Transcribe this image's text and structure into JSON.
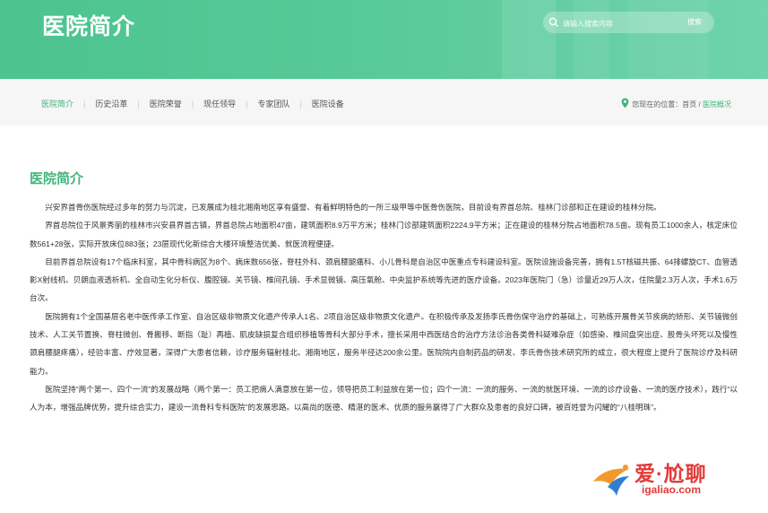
{
  "banner": {
    "title": "医院简介"
  },
  "search": {
    "placeholder": "请输入搜索内容",
    "button": "搜索"
  },
  "nav": {
    "tabs": [
      "医院简介",
      "历史沿革",
      "医院荣誉",
      "现任领导",
      "专家团队",
      "医院设备"
    ],
    "active": 0,
    "separator": "|"
  },
  "breadcrumb": {
    "label": "您现在的位置：",
    "home": "首页",
    "separator": "/",
    "current": "医院概况"
  },
  "content": {
    "title": "医院简介",
    "paragraphs": [
      "兴安界首骨伤医院经过多年的努力与沉淀，已发展成为桂北湘南地区享有盛誉、有着鲜明特色的一所三级甲等中医骨伤医院，目前设有界首总院、桂林门诊部和正在建设的桂林分院。",
      "界首总院位于风景秀丽的桂林市兴安县界首古镇，界首总院占地面积47亩，建筑面积8.9万平方米；桂林门诊部建筑面积2224.9平方米；正在建设的桂林分院占地面积78.5亩。现有员工1000余人，核定床位数561+28张，实际开放床位883张；23层现代化新综合大楼环境整洁优美、就医流程便捷。",
      "目前界首总院设有17个临床科室，其中骨科病区为8个、病床数656张，脊柱外科、颈肩腰腿痛科、小儿骨科是自治区中医重点专科建设科室。医院设施设备完善，拥有1.5T核磁共振、64排螺旋CT、血管透影X射线机、贝朗血液透析机、全自动生化分析仪、腹腔镜、关节镜、椎间孔镜、手术显微镜、高压氧舱、中央监护系统等先进的医疗设备。2023年医院门（急）诊量近29万人次，住院量2.3万人次，手术1.6万台次。",
      "医院拥有1个全国基层名老中医传承工作室、自治区级非物质文化遗产传承人1名、2项自治区级非物质文化遗产。在积极传承及发扬李氏骨伤保守治疗的基础上，可熟练开展骨关节疾病的矫形、关节镜微创技术、人工关节置换、脊柱微创、骨搬移、断指（趾）再植、肌皮缺损复合组织移植等骨科大部分手术，擅长采用中西医结合的治疗方法诊治各类骨科疑难杂症（如感染、椎间盘突出症、股骨头坏死以及慢性颈肩腰腿疼痛），经验丰富、疗效显著，深得广大患者信赖，诊疗服务辐射桂北、湘南地区，服务半径达200余公里。医院院内自制药品的研发、李氏骨伤技术研究所的成立，很大程度上提升了医院诊疗及科研能力。",
      "医院坚持“两个第一、四个一流”的发展战略（两个第一：员工把病人满意放在第一位，领导把员工利益放在第一位；四个一流：一流的服务、一流的就医环境、一流的诊疗设备、一流的医疗技术），践行“以人为本，增强品牌优势，提升综合实力，建设一流骨科专科医院”的发展思路。以高尚的医德、精湛的医术、优质的服务赢得了广大群众及患者的良好口碑，被百姓誉为闪耀的“八桂明珠”。"
    ]
  },
  "watermark": {
    "text": "爱·尬聊",
    "url": "igaliao.com"
  },
  "colors": {
    "accent": "#3fb57a",
    "banner": "#57c998",
    "watermark": "#e23a3a"
  }
}
